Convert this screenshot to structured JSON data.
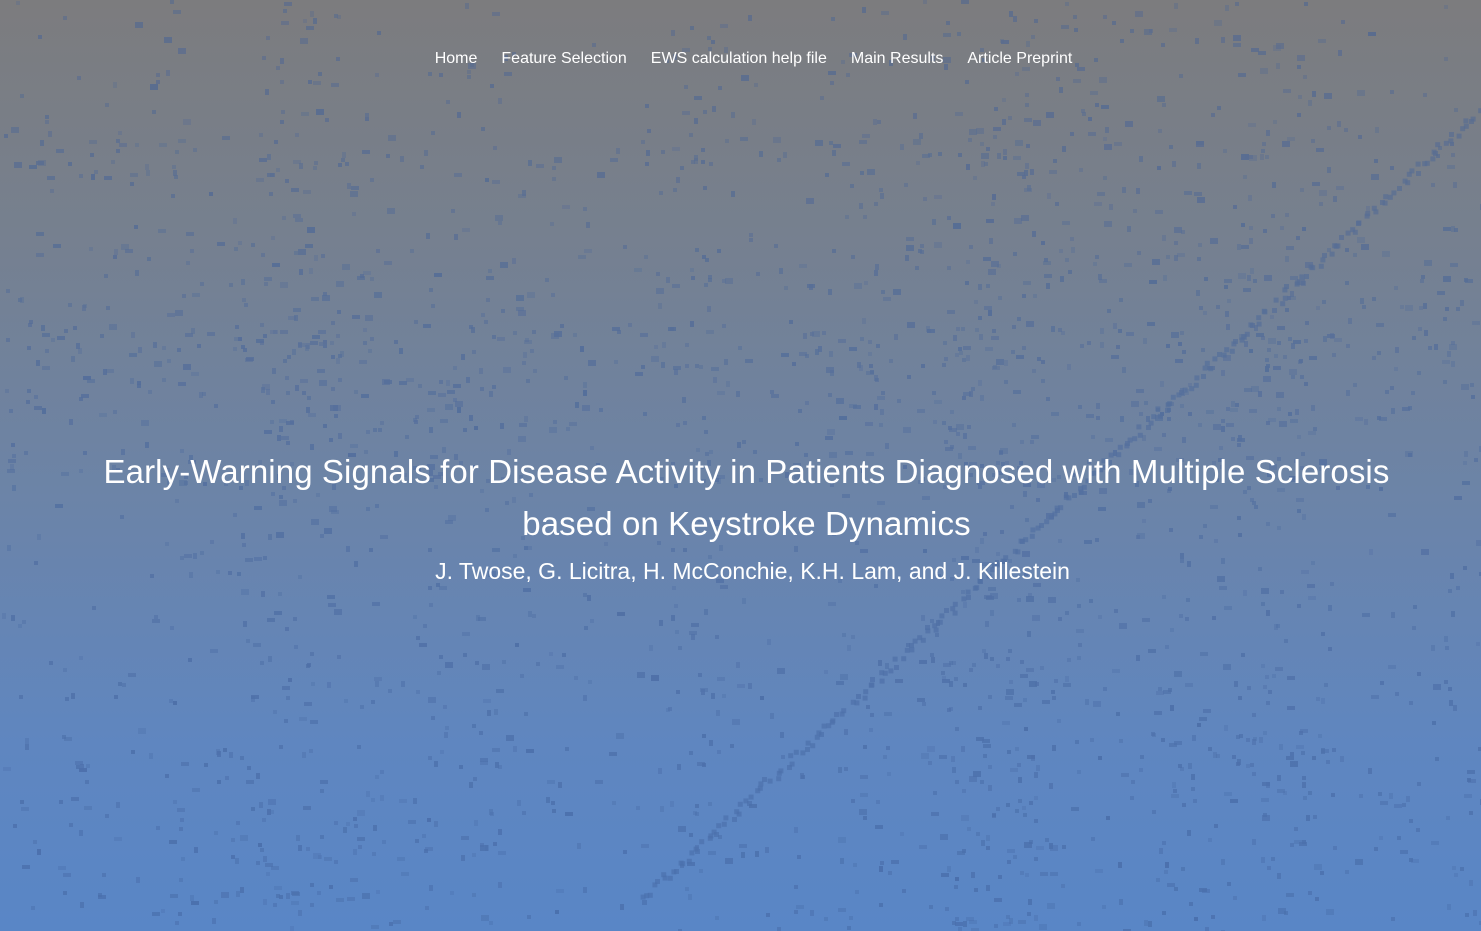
{
  "nav": {
    "items": [
      {
        "label": "Home"
      },
      {
        "label": "Feature Selection"
      },
      {
        "label": "EWS calculation help file"
      },
      {
        "label": "Main Results"
      },
      {
        "label": "Article Preprint"
      }
    ]
  },
  "hero": {
    "title": "Early-Warning Signals for Disease Activity in Patients Diagnosed with Multiple Sclerosis based on Keystroke Dynamics",
    "authors": "J. Twose, G. Licitra, H. McConchie, K.H. Lam, and J. Killestein"
  },
  "colors": {
    "top": "#7c7c7e",
    "bottom": "#5986c6",
    "pattern": "#3f5f9a",
    "text": "#ffffff"
  }
}
